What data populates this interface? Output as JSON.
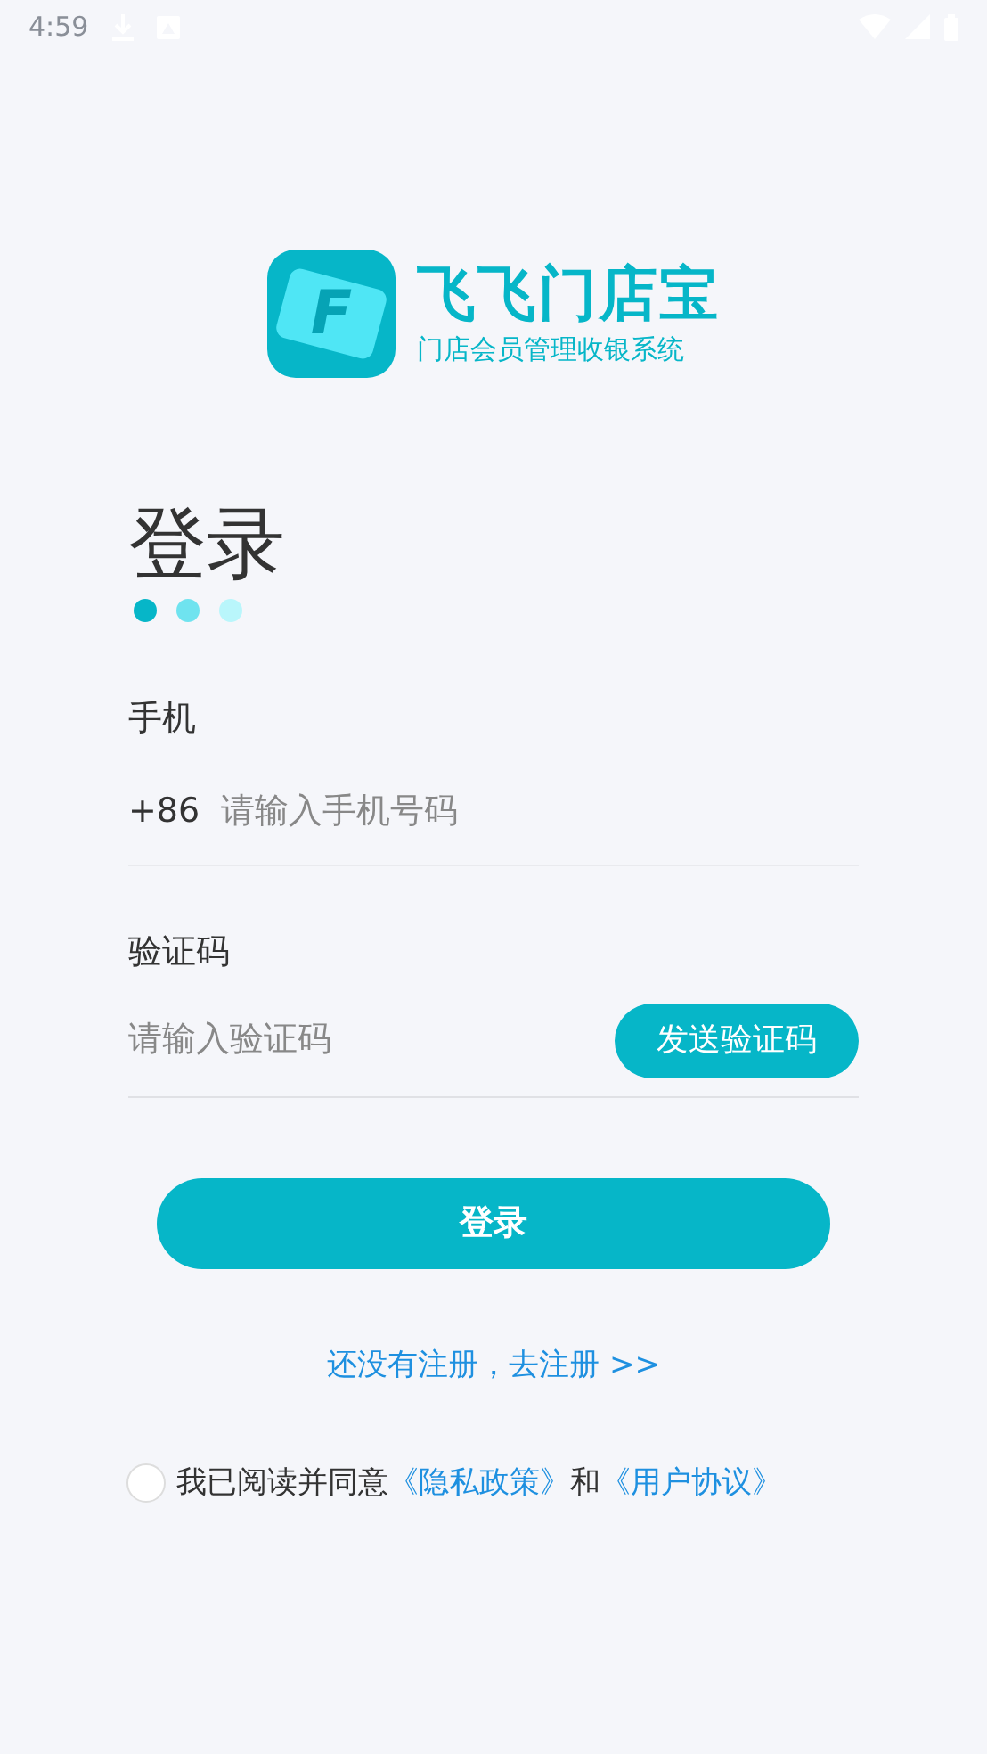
{
  "status_bar": {
    "time": "4:59"
  },
  "brand": {
    "logo_letter": "F",
    "name": "飞飞门店宝",
    "tagline": "门店会员管理收银系统"
  },
  "heading": "登录",
  "dots": [
    {
      "color": "#06b6c8"
    },
    {
      "color": "#6fe3ef"
    },
    {
      "color": "#b9f6fb"
    }
  ],
  "phone": {
    "label": "手机",
    "prefix": "+86",
    "placeholder": "请输入手机号码"
  },
  "code": {
    "label": "验证码",
    "placeholder": "请输入验证码",
    "button": "发送验证码"
  },
  "login_button": "登录",
  "register_link": "还没有注册，去注册 >>",
  "agreement": {
    "checked": false,
    "text": "我已阅读并同意",
    "privacy": "《隐私政策》",
    "and": "和",
    "terms": "《用户协议》"
  }
}
